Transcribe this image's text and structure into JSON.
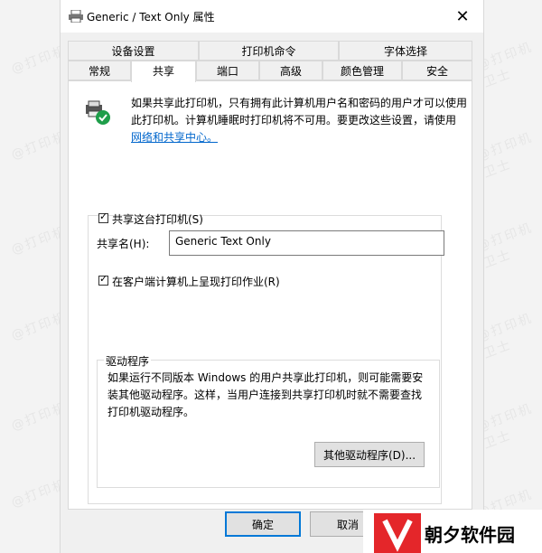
{
  "window": {
    "title": "Generic / Text Only 属性"
  },
  "tabs_row1": [
    "设备设置",
    "打印机命令",
    "字体选择"
  ],
  "tabs_row2": [
    "常规",
    "共享",
    "端口",
    "高级",
    "颜色管理",
    "安全"
  ],
  "active_tab": "共享",
  "description": {
    "text": "如果共享此打印机，只有拥有此计算机用户名和密码的用户才可以使用此打印机。计算机睡眠时打印机将不可用。要更改这些设置，请使用",
    "link": "网络和共享中心。"
  },
  "share_checkbox": {
    "label": "共享这台打印机(S)",
    "checked": true
  },
  "share_name": {
    "label": "共享名(H):",
    "value": "Generic  Text Only"
  },
  "render_checkbox": {
    "label": "在客户端计算机上呈现打印作业(R)",
    "checked": true
  },
  "drivers": {
    "legend": "驱动程序",
    "text": "如果运行不同版本 Windows 的用户共享此打印机，则可能需要安装其他驱动程序。这样，当用户连接到共享打印机时就不需要查找打印机驱动程序。",
    "button": "其他驱动程序(D)..."
  },
  "buttons": {
    "ok": "确定",
    "cancel": "取消"
  },
  "watermark": "@打印机卫士",
  "brand": {
    "name": "朝夕软件园"
  },
  "colors": {
    "link": "#0066cc",
    "accent": "#0078d7",
    "brand_red": "#e4262a"
  }
}
